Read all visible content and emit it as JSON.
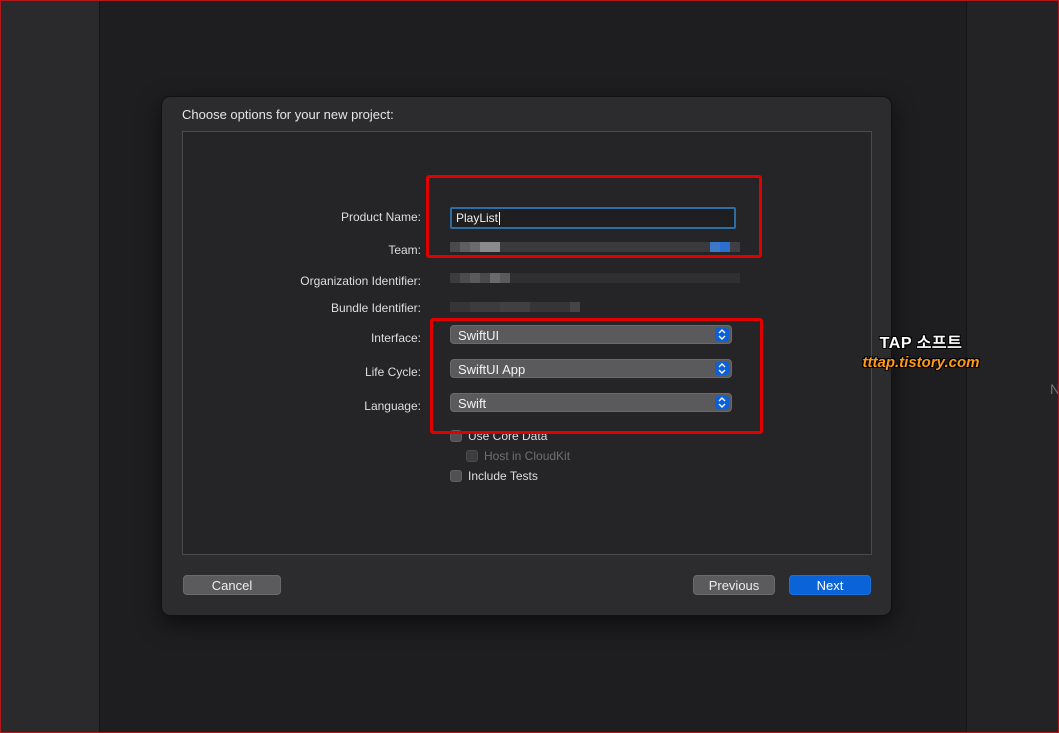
{
  "sheet": {
    "title": "Choose options for your new project:"
  },
  "form": {
    "product_name_label": "Product Name:",
    "product_name_value": "PlayList",
    "team_label": "Team:",
    "org_id_label": "Organization Identifier:",
    "bundle_id_label": "Bundle Identifier:",
    "interface_label": "Interface:",
    "interface_value": "SwiftUI",
    "lifecycle_label": "Life Cycle:",
    "lifecycle_value": "SwiftUI App",
    "language_label": "Language:",
    "language_value": "Swift",
    "use_core_data_label": "Use Core Data",
    "use_core_data_checked": false,
    "host_cloudkit_label": "Host in CloudKit",
    "host_cloudkit_checked": false,
    "include_tests_label": "Include Tests",
    "include_tests_checked": false
  },
  "buttons": {
    "cancel": "Cancel",
    "previous": "Previous",
    "next": "Next"
  },
  "watermark": {
    "line1": "TAP 소프트",
    "line2": "tttap.tistory.com"
  },
  "colors": {
    "accent": "#0a64d8",
    "annotation_red": "#e00000",
    "watermark_orange": "#ff9a1a"
  },
  "icons": {
    "popup_stepper": "chevron-up-down-icon"
  }
}
